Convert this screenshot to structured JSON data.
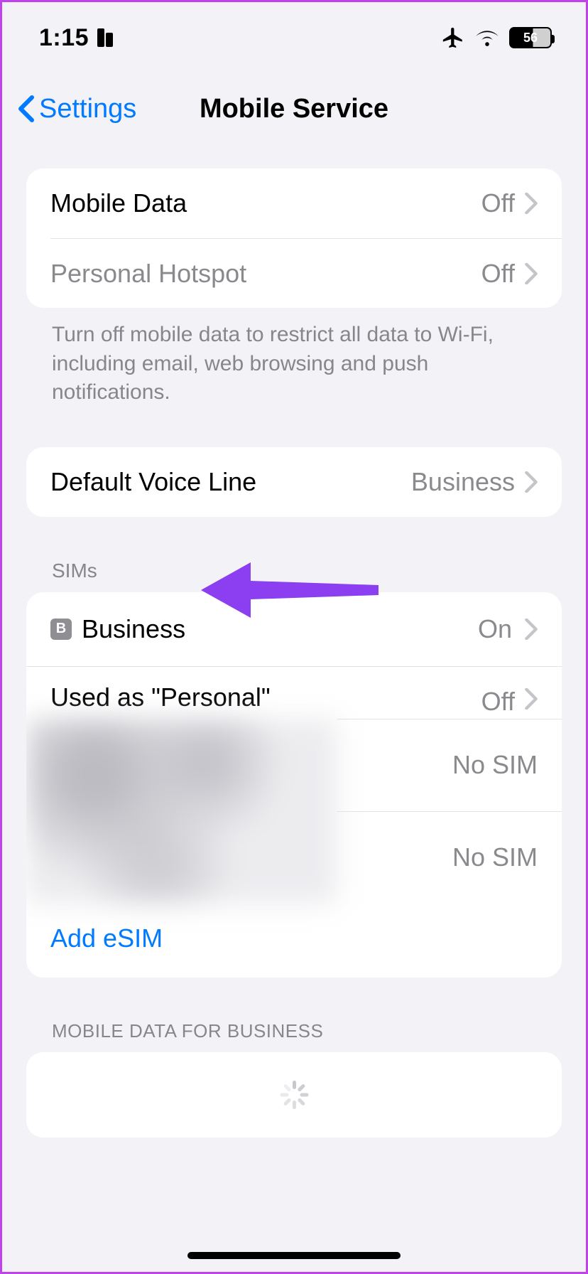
{
  "status": {
    "time": "1:15",
    "battery_pct": "56"
  },
  "nav": {
    "back_label": "Settings",
    "title": "Mobile Service"
  },
  "group1": {
    "mobile_data_label": "Mobile Data",
    "mobile_data_value": "Off",
    "hotspot_label": "Personal Hotspot",
    "hotspot_value": "Off",
    "footer": "Turn off mobile data to restrict all data to Wi-Fi, including email, web browsing and push notifications."
  },
  "group2": {
    "voice_line_label": "Default Voice Line",
    "voice_line_value": "Business"
  },
  "sims": {
    "header": "SIMs",
    "items": [
      {
        "badge": "B",
        "label": "Business",
        "value": "On"
      }
    ],
    "used_as_label": "Used as \"Personal\"",
    "used_as_value": "Off",
    "no_sim_1": "No SIM",
    "no_sim_2": "No SIM",
    "add_esim": "Add eSIM"
  },
  "mobile_data_for": {
    "header": "MOBILE DATA FOR BUSINESS"
  }
}
